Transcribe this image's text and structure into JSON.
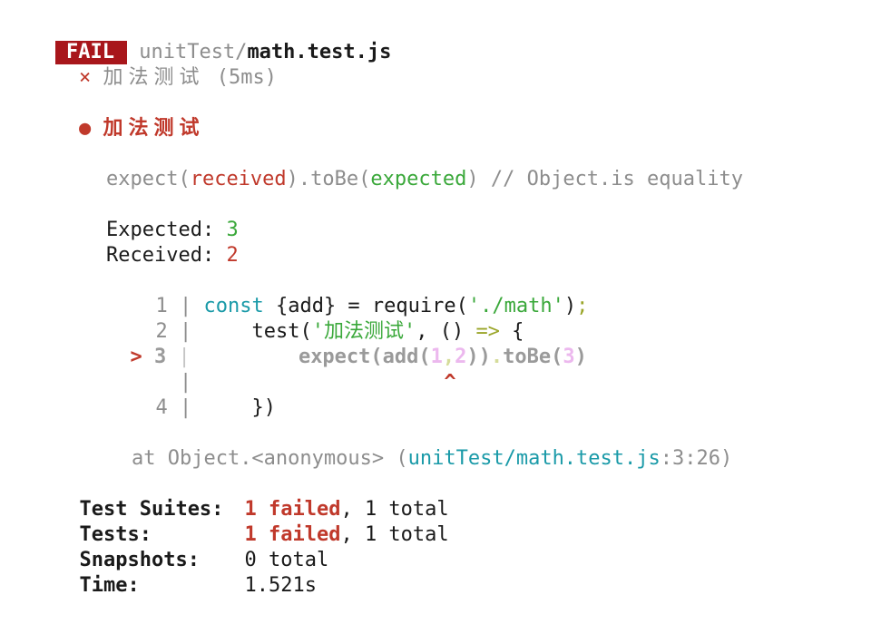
{
  "header": {
    "status_badge": "FAIL",
    "path_dir": "unitTest/",
    "path_file": "math.test.js"
  },
  "test_result": {
    "fail_icon": "×",
    "test_name": "加法测试",
    "duration": "(5ms)"
  },
  "failure": {
    "bullet_icon": "●",
    "title": "加法测试",
    "matcher": {
      "prefix": "expect(",
      "received": "received",
      "mid": ").toBe(",
      "expected": "expected",
      "suffix": ") // Object.is equality"
    },
    "expected_label": "Expected: ",
    "expected_value": "3",
    "received_label": "Received: ",
    "received_value": "2"
  },
  "code_frame": {
    "line1": {
      "num": "1",
      "sep": " | ",
      "kw": "const",
      "a": " {add} = require(",
      "str": "'./math'",
      "b": ")",
      "semi": ";"
    },
    "line2": {
      "num": "2",
      "sep": " | ",
      "a": "    test(",
      "str": "'加法测试'",
      "b": ", () ",
      "arrow": "=>",
      "c": " {"
    },
    "line3": {
      "marker": ">",
      "num": "3",
      "sep": " | ",
      "a": "        expect(add(",
      "n1": "1",
      "comma": ",",
      "n2": "2",
      "b": "))",
      "dot": ".",
      "c": "toBe(",
      "n3": "3",
      "d": ")"
    },
    "pointer": {
      "sep": "|",
      "caret": "^"
    },
    "line4": {
      "num": "4",
      "sep": " | ",
      "a": "    })"
    }
  },
  "stack": {
    "prefix": "at Object.<anonymous> (",
    "path": "unitTest/math.test.js",
    "suffix": ":3:26)"
  },
  "summary": {
    "suites_label": "Test Suites:",
    "suites_failed": "1 failed",
    "suites_total": ", 1 total",
    "tests_label": "Tests:",
    "tests_failed": "1 failed",
    "tests_total": ", 1 total",
    "snapshots_label": "Snapshots:",
    "snapshots_value": "0 total",
    "time_label": "Time:",
    "time_value": "1.521s"
  },
  "colors": {
    "fail_badge_bg": "#a8161b",
    "error_red": "#c0392b",
    "success_green": "#3aa83a",
    "path_teal": "#1a9aa8",
    "dim_gray": "#8d8d8d"
  }
}
